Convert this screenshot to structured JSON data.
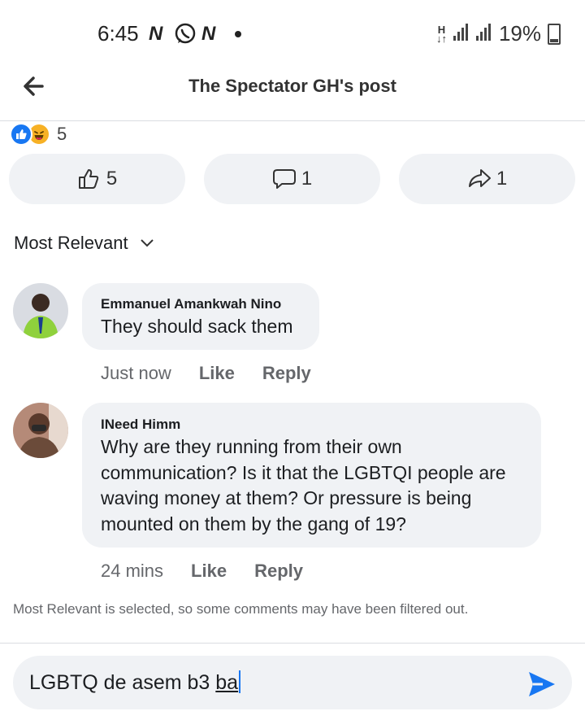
{
  "status_bar": {
    "time": "6:45",
    "notif_icons": [
      "N",
      "whatsapp-icon",
      "N"
    ],
    "network": "H",
    "battery": "19%"
  },
  "header": {
    "title": "The Spectator GH's post"
  },
  "reactions": {
    "count": "5",
    "types": [
      "like",
      "haha"
    ]
  },
  "actions": {
    "likes": "5",
    "comments": "1",
    "shares": "1"
  },
  "sort": {
    "label": "Most Relevant"
  },
  "comments": [
    {
      "name": "Emmanuel Amankwah Nino",
      "text": "They should sack them",
      "time": "Just now",
      "like": "Like",
      "reply": "Reply"
    },
    {
      "name": "INeed Himm",
      "text": "Why are they running from their own communication? Is it that the LGBTQI people are waving money at them? Or pressure is being mounted on them by the gang of 19?",
      "time": "24 mins",
      "like": "Like",
      "reply": "Reply"
    }
  ],
  "filter_note": "Most Relevant is selected, so some comments may have been filtered out.",
  "composer": {
    "text_before": "LGBTQ de asem b3 ",
    "text_underlined": "ba"
  },
  "colors": {
    "accent": "#1877f2",
    "bubble": "#f0f2f5",
    "muted": "#65676b",
    "haha": "#f7b125"
  }
}
